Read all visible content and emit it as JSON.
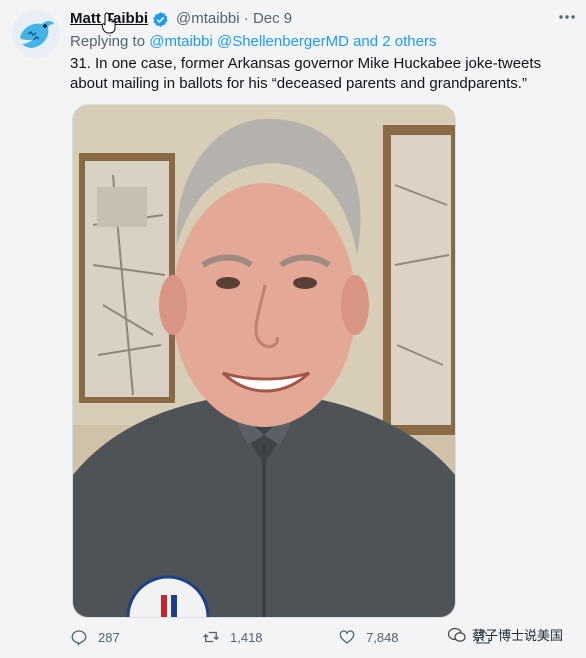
{
  "tweet": {
    "author_name": "Matt Taibbi",
    "author_handle": "@mtaibbi",
    "separator": "·",
    "date": "Dec 9",
    "replying_prefix": "Replying to ",
    "replying_links": "@mtaibbi @ShellenbergerMD and 2 others",
    "text": "31. In one case, former Arkansas governor Mike Huckabee joke-tweets about mailing in ballots for his “deceased parents and grandparents.”"
  },
  "actions": {
    "replies": "287",
    "retweets": "1,418",
    "likes": "7,848"
  },
  "watermark": {
    "text": "蔡子博士说美国"
  },
  "icons": [
    "twitter-bird-avatar",
    "verified-icon",
    "more-icon",
    "reply-icon",
    "retweet-icon",
    "like-icon",
    "share-icon",
    "wechat-icon",
    "hand-cursor-icon"
  ],
  "colors": {
    "link": "#1d9bf0",
    "muted": "#536471",
    "text": "#0f1419",
    "verified": "#1d9bf0"
  }
}
